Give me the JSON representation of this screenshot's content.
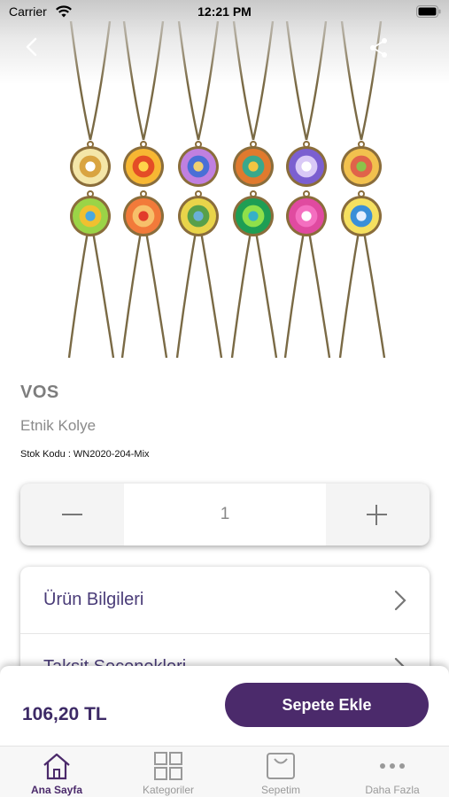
{
  "status_bar": {
    "carrier": "Carrier",
    "time": "12:21 PM"
  },
  "product": {
    "brand": "VOS",
    "name": "Etnik Kolye",
    "sku": "Stok Kodu : WN2020-204-Mix",
    "image_alt_icon": "necklace-collection-image"
  },
  "quantity": {
    "value": "1"
  },
  "info_rows": [
    {
      "label": "Ürün Bilgileri"
    },
    {
      "label": "Taksit Seçenekleri"
    }
  ],
  "buy_bar": {
    "price": "106,20 TL",
    "add_to_cart_label": "Sepete Ekle"
  },
  "tabs": [
    {
      "label": "Ana Sayfa",
      "icon": "home-icon",
      "active": true
    },
    {
      "label": "Kategoriler",
      "icon": "grid-icon",
      "active": false
    },
    {
      "label": "Sepetim",
      "icon": "bag-icon",
      "active": false
    },
    {
      "label": "Daha Fazla",
      "icon": "more-icon",
      "active": false
    }
  ],
  "colors": {
    "accent": "#4b2a6b",
    "price": "#3d2a66",
    "info_label": "#4a3c78"
  }
}
